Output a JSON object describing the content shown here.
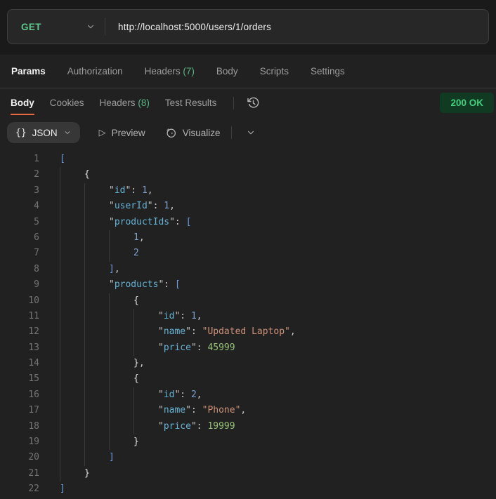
{
  "request": {
    "method": "GET",
    "url": "http://localhost:5000/users/1/orders"
  },
  "request_tabs": [
    {
      "label": "Params",
      "active": true
    },
    {
      "label": "Authorization"
    },
    {
      "label": "Headers",
      "count": "(7)"
    },
    {
      "label": "Body"
    },
    {
      "label": "Scripts"
    },
    {
      "label": "Settings"
    }
  ],
  "response_tabs": [
    {
      "label": "Body",
      "active": true
    },
    {
      "label": "Cookies"
    },
    {
      "label": "Headers",
      "count": "(8)"
    },
    {
      "label": "Test Results"
    }
  ],
  "icons": {
    "method_chevron": "chevron-down-icon",
    "history": "history-clock-icon",
    "visualize": "sparkle-wand-icon",
    "preview_play": "play-icon"
  },
  "status": {
    "text": "200 OK"
  },
  "toolbar": {
    "format_glyph": "{}",
    "format": "JSON",
    "preview": "Preview",
    "visualize": "Visualize"
  },
  "colors": {
    "method_green": "#5fc98f",
    "count_green": "#55b885",
    "status_text": "#43cf7c",
    "status_bg": "#113a23",
    "accent_orange": "#e8683e",
    "key_cyan": "#66b2d6",
    "string_orange": "#ce9178",
    "number_blue": "#7ba2d0",
    "number_green": "#98c379",
    "bracket_blue": "#6e9ce0"
  },
  "code": {
    "lines": [
      {
        "n": 1,
        "indent": 0,
        "tokens": [
          [
            "sb",
            "["
          ]
        ]
      },
      {
        "n": 2,
        "indent": 1,
        "tokens": [
          [
            "cb",
            "{"
          ]
        ]
      },
      {
        "n": 3,
        "indent": 2,
        "tokens": [
          [
            "pu",
            "\""
          ],
          [
            "ky",
            "id"
          ],
          [
            "pu",
            "\": "
          ],
          [
            "nb",
            "1"
          ],
          [
            "pu",
            ","
          ]
        ]
      },
      {
        "n": 4,
        "indent": 2,
        "tokens": [
          [
            "pu",
            "\""
          ],
          [
            "ky",
            "userId"
          ],
          [
            "pu",
            "\": "
          ],
          [
            "nb",
            "1"
          ],
          [
            "pu",
            ","
          ]
        ]
      },
      {
        "n": 5,
        "indent": 2,
        "tokens": [
          [
            "pu",
            "\""
          ],
          [
            "ky",
            "productIds"
          ],
          [
            "pu",
            "\": "
          ],
          [
            "sb",
            "["
          ]
        ]
      },
      {
        "n": 6,
        "indent": 3,
        "tokens": [
          [
            "nb",
            "1"
          ],
          [
            "pu",
            ","
          ]
        ]
      },
      {
        "n": 7,
        "indent": 3,
        "tokens": [
          [
            "nb",
            "2"
          ]
        ]
      },
      {
        "n": 8,
        "indent": 2,
        "tokens": [
          [
            "sb",
            "]"
          ],
          [
            "pu",
            ","
          ]
        ]
      },
      {
        "n": 9,
        "indent": 2,
        "tokens": [
          [
            "pu",
            "\""
          ],
          [
            "ky",
            "products"
          ],
          [
            "pu",
            "\": "
          ],
          [
            "sb",
            "["
          ]
        ]
      },
      {
        "n": 10,
        "indent": 3,
        "tokens": [
          [
            "cb",
            "{"
          ]
        ]
      },
      {
        "n": 11,
        "indent": 4,
        "tokens": [
          [
            "pu",
            "\""
          ],
          [
            "ky",
            "id"
          ],
          [
            "pu",
            "\": "
          ],
          [
            "nb",
            "1"
          ],
          [
            "pu",
            ","
          ]
        ]
      },
      {
        "n": 12,
        "indent": 4,
        "tokens": [
          [
            "pu",
            "\""
          ],
          [
            "ky",
            "name"
          ],
          [
            "pu",
            "\": "
          ],
          [
            "st",
            "\"Updated Laptop\""
          ],
          [
            "pu",
            ","
          ]
        ]
      },
      {
        "n": 13,
        "indent": 4,
        "tokens": [
          [
            "pu",
            "\""
          ],
          [
            "ky",
            "price"
          ],
          [
            "pu",
            "\": "
          ],
          [
            "ng",
            "45999"
          ]
        ]
      },
      {
        "n": 14,
        "indent": 3,
        "tokens": [
          [
            "cb",
            "}"
          ],
          [
            "pu",
            ","
          ]
        ]
      },
      {
        "n": 15,
        "indent": 3,
        "tokens": [
          [
            "cb",
            "{"
          ]
        ]
      },
      {
        "n": 16,
        "indent": 4,
        "tokens": [
          [
            "pu",
            "\""
          ],
          [
            "ky",
            "id"
          ],
          [
            "pu",
            "\": "
          ],
          [
            "nb",
            "2"
          ],
          [
            "pu",
            ","
          ]
        ]
      },
      {
        "n": 17,
        "indent": 4,
        "tokens": [
          [
            "pu",
            "\""
          ],
          [
            "ky",
            "name"
          ],
          [
            "pu",
            "\": "
          ],
          [
            "st",
            "\"Phone\""
          ],
          [
            "pu",
            ","
          ]
        ]
      },
      {
        "n": 18,
        "indent": 4,
        "tokens": [
          [
            "pu",
            "\""
          ],
          [
            "ky",
            "price"
          ],
          [
            "pu",
            "\": "
          ],
          [
            "ng",
            "19999"
          ]
        ]
      },
      {
        "n": 19,
        "indent": 3,
        "tokens": [
          [
            "cb",
            "}"
          ]
        ]
      },
      {
        "n": 20,
        "indent": 2,
        "tokens": [
          [
            "sb",
            "]"
          ]
        ]
      },
      {
        "n": 21,
        "indent": 1,
        "tokens": [
          [
            "cb",
            "}"
          ]
        ]
      },
      {
        "n": 22,
        "indent": 0,
        "tokens": [
          [
            "sb",
            "]"
          ]
        ]
      }
    ]
  }
}
